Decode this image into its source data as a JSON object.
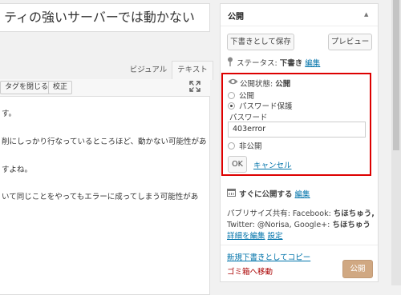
{
  "editor": {
    "title": "ティの強いサーバーでは動かない",
    "tabs": {
      "visual": "ビジュアル",
      "text": "テキスト"
    },
    "toolbar": {
      "close_tags": "タグを閉じる",
      "proofread": "校正"
    },
    "lines": [
      "す。",
      "削にしっかり行なっているところほど、動かない可能性があ",
      "すよね。",
      "いて同じことをやってもエラーに成ってしまう可能性があ"
    ]
  },
  "publish": {
    "title": "公開",
    "save_draft": "下書きとして保存",
    "preview": "プレビュー",
    "status_label": "ステータス:",
    "status_value": "下書き",
    "edit": "編集",
    "visibility_label": "公開状態:",
    "visibility_value": "公開",
    "options": [
      "公開",
      "パスワード保護",
      "非公開"
    ],
    "selected_option": "パスワード保護",
    "password_label": "パスワード",
    "password_value": "403error",
    "ok": "OK",
    "cancel": "キャンセル",
    "schedule_label": "すぐに公開する",
    "share_line1_a": "パブリサイズ共有: Facebook: ",
    "share_line1_b": "ちほちゅう,",
    "share_line2_a": "Twitter: @Norisa, Google+: ",
    "share_line2_b": "ちほちゅう",
    "edit_details": "詳細を編集",
    "settings": "設定",
    "copy_draft": "新規下書きとしてコピー",
    "trash": "ゴミ箱へ移動",
    "publish_button": "公開"
  },
  "colors": {
    "highlight_border": "#dd0000",
    "link": "#0073aa",
    "trash": "#aa0000",
    "publish_button": "#d0a882"
  },
  "icons": [
    "pin-icon",
    "eye-icon",
    "calendar-icon",
    "fullscreen-icon",
    "collapse-arrow-icon"
  ]
}
